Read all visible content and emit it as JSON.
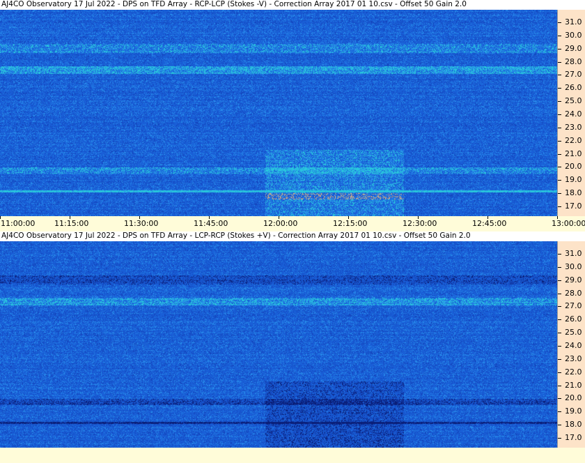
{
  "panels": [
    {
      "title": "AJ4CO Observatory 17 Jul 2022  -  DPS on TFD Array  -  RCP-LCP (Stokes -V)  -  Correction Array 2017 01 10.csv  -  Offset 50  Gain 2.0",
      "polarity": "rcp-minus-lcp",
      "time_labels": [
        "11:00:00",
        "11:15:00",
        "11:30:00",
        "11:45:00",
        "12:00:00",
        "12:15:00",
        "12:30:00",
        "12:45:00",
        "13:00:00"
      ]
    },
    {
      "title": "AJ4CO Observatory 17 Jul 2022  -  DPS on TFD Array  -  LCP-RCP (Stokes +V)  -  Correction Array 2017 01 10.csv  -  Offset 50  Gain 2.0",
      "polarity": "lcp-minus-rcp",
      "time_labels": []
    }
  ],
  "freq_labels": [
    "31.0",
    "30.0",
    "29.0",
    "28.0",
    "27.0",
    "26.0",
    "25.0",
    "24.0",
    "23.0",
    "22.0",
    "21.0",
    "20.0",
    "19.0",
    "18.0",
    "17.0"
  ],
  "colors": {
    "spectrogram_base": "#1e63e0",
    "freq_axis_bg": "#fde3c8",
    "time_axis_bg": "#fffcd9"
  }
}
